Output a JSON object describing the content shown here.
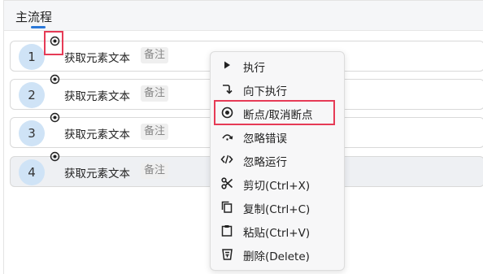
{
  "tab": {
    "label": "主流程"
  },
  "rows": [
    {
      "index": "1",
      "title": "获取元素文本",
      "note": "备注"
    },
    {
      "index": "2",
      "title": "获取元素文本",
      "note": "备注"
    },
    {
      "index": "3",
      "title": "获取元素文本",
      "note": "备注"
    },
    {
      "index": "4",
      "title": "获取元素文本",
      "note": "备注"
    }
  ],
  "context_menu": {
    "items": [
      {
        "label": "执行",
        "icon": "play-icon"
      },
      {
        "label": "向下执行",
        "icon": "arrow-down-right-icon"
      },
      {
        "label": "断点/取消断点",
        "icon": "breakpoint-icon"
      },
      {
        "label": "忽略错误",
        "icon": "skip-arc-icon"
      },
      {
        "label": "忽略运行",
        "icon": "code-icon"
      },
      {
        "label": "剪切(Ctrl+X)",
        "icon": "scissors-icon"
      },
      {
        "label": "复制(Ctrl+C)",
        "icon": "copy-icon"
      },
      {
        "label": "粘贴(Ctrl+V)",
        "icon": "clipboard-icon"
      },
      {
        "label": "删除(Delete)",
        "icon": "trash-icon"
      }
    ]
  },
  "colors": {
    "accent": "#2b78d8",
    "highlight_box": "#e63b56",
    "step_circle": "#cfe3f6",
    "selected_row": "#eef0f3"
  }
}
